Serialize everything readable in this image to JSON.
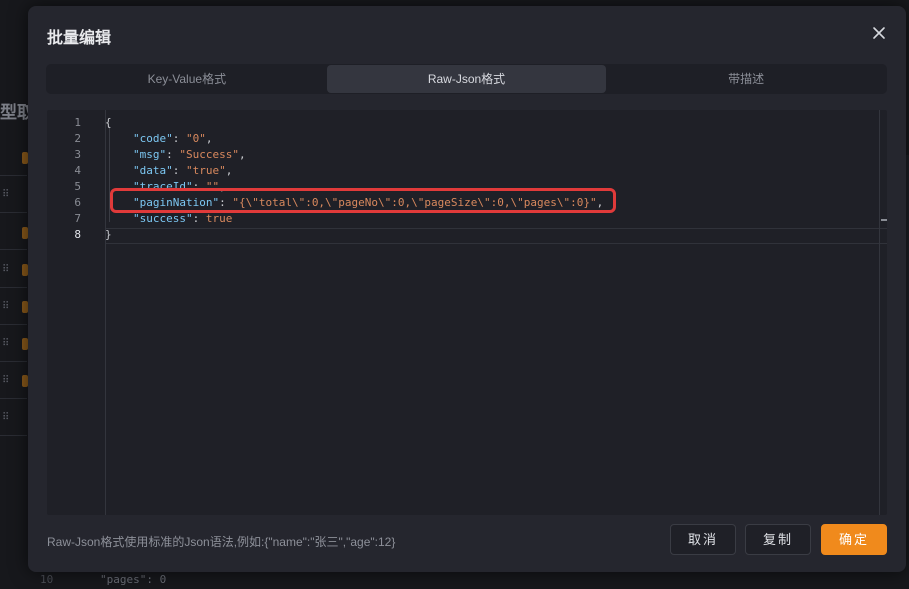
{
  "background": {
    "left_heading": "型取守",
    "bottom_line_number": "10",
    "bottom_code": "\"pages\": 0"
  },
  "modal": {
    "title": "批量编辑",
    "tabs": [
      {
        "label": "Key-Value格式",
        "active": false
      },
      {
        "label": "Raw-Json格式",
        "active": true
      },
      {
        "label": "带描述",
        "active": false
      }
    ],
    "editor": {
      "line_numbers": [
        "1",
        "2",
        "3",
        "4",
        "5",
        "6",
        "7",
        "8"
      ],
      "current_line": "8",
      "lines": {
        "l1": "{",
        "l2_key": "\"code\"",
        "l2_val": "\"0\"",
        "l3_key": "\"msg\"",
        "l3_val": "\"Success\"",
        "l4_key": "\"data\"",
        "l4_val": "\"true\"",
        "l5_key": "\"traceId\"",
        "l5_val": "\"\"",
        "l6_key": "\"paginNation\"",
        "l6_val": "\"{\\\"total\\\":0,\\\"pageNo\\\":0,\\\"pageSize\\\":0,\\\"pages\\\":0}\"",
        "l7_key": "\"success\"",
        "l7_val": "true",
        "l8": "}"
      }
    },
    "hint": "Raw-Json格式使用标准的Json语法,例如:{\"name\":\"张三\",\"age\":12}",
    "buttons": {
      "cancel": "取消",
      "copy": "复制",
      "confirm": "确定"
    },
    "colors": {
      "accent": "#f08a1c",
      "highlight_border": "#e03a3a",
      "json_key": "#7cc7f2",
      "json_string": "#d9895e"
    }
  }
}
